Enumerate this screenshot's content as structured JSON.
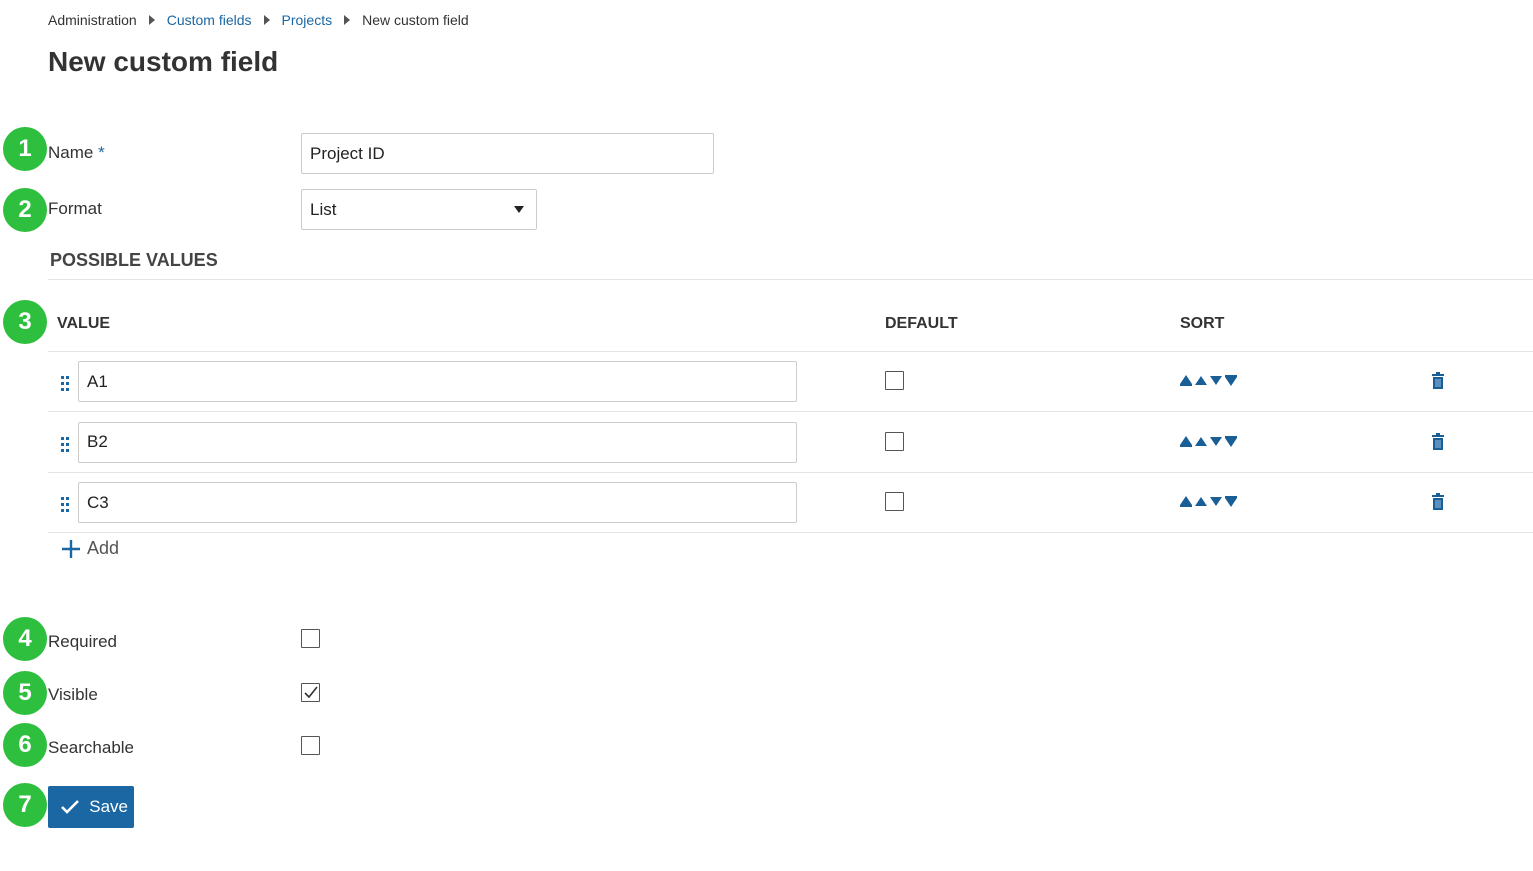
{
  "breadcrumb": [
    "Administration",
    "Custom fields",
    "Projects",
    "New custom field"
  ],
  "title": "New custom field",
  "name": {
    "label": "Name",
    "required_mark": "*",
    "value": "Project ID"
  },
  "format": {
    "label": "Format",
    "value": "List"
  },
  "possible_values": {
    "heading": "POSSIBLE VALUES",
    "col_value": "VALUE",
    "col_default": "DEFAULT",
    "col_sort": "SORT",
    "rows": [
      {
        "value": "A1",
        "default": false
      },
      {
        "value": "B2",
        "default": false
      },
      {
        "value": "C3",
        "default": false
      }
    ],
    "add_label": "Add"
  },
  "required": {
    "label": "Required",
    "checked": false
  },
  "visible": {
    "label": "Visible",
    "checked": true
  },
  "searchable": {
    "label": "Searchable",
    "checked": false
  },
  "save_label": "Save",
  "accent": "#1a67a3",
  "annotations": [
    "1",
    "2",
    "3",
    "4",
    "5",
    "6",
    "7"
  ]
}
